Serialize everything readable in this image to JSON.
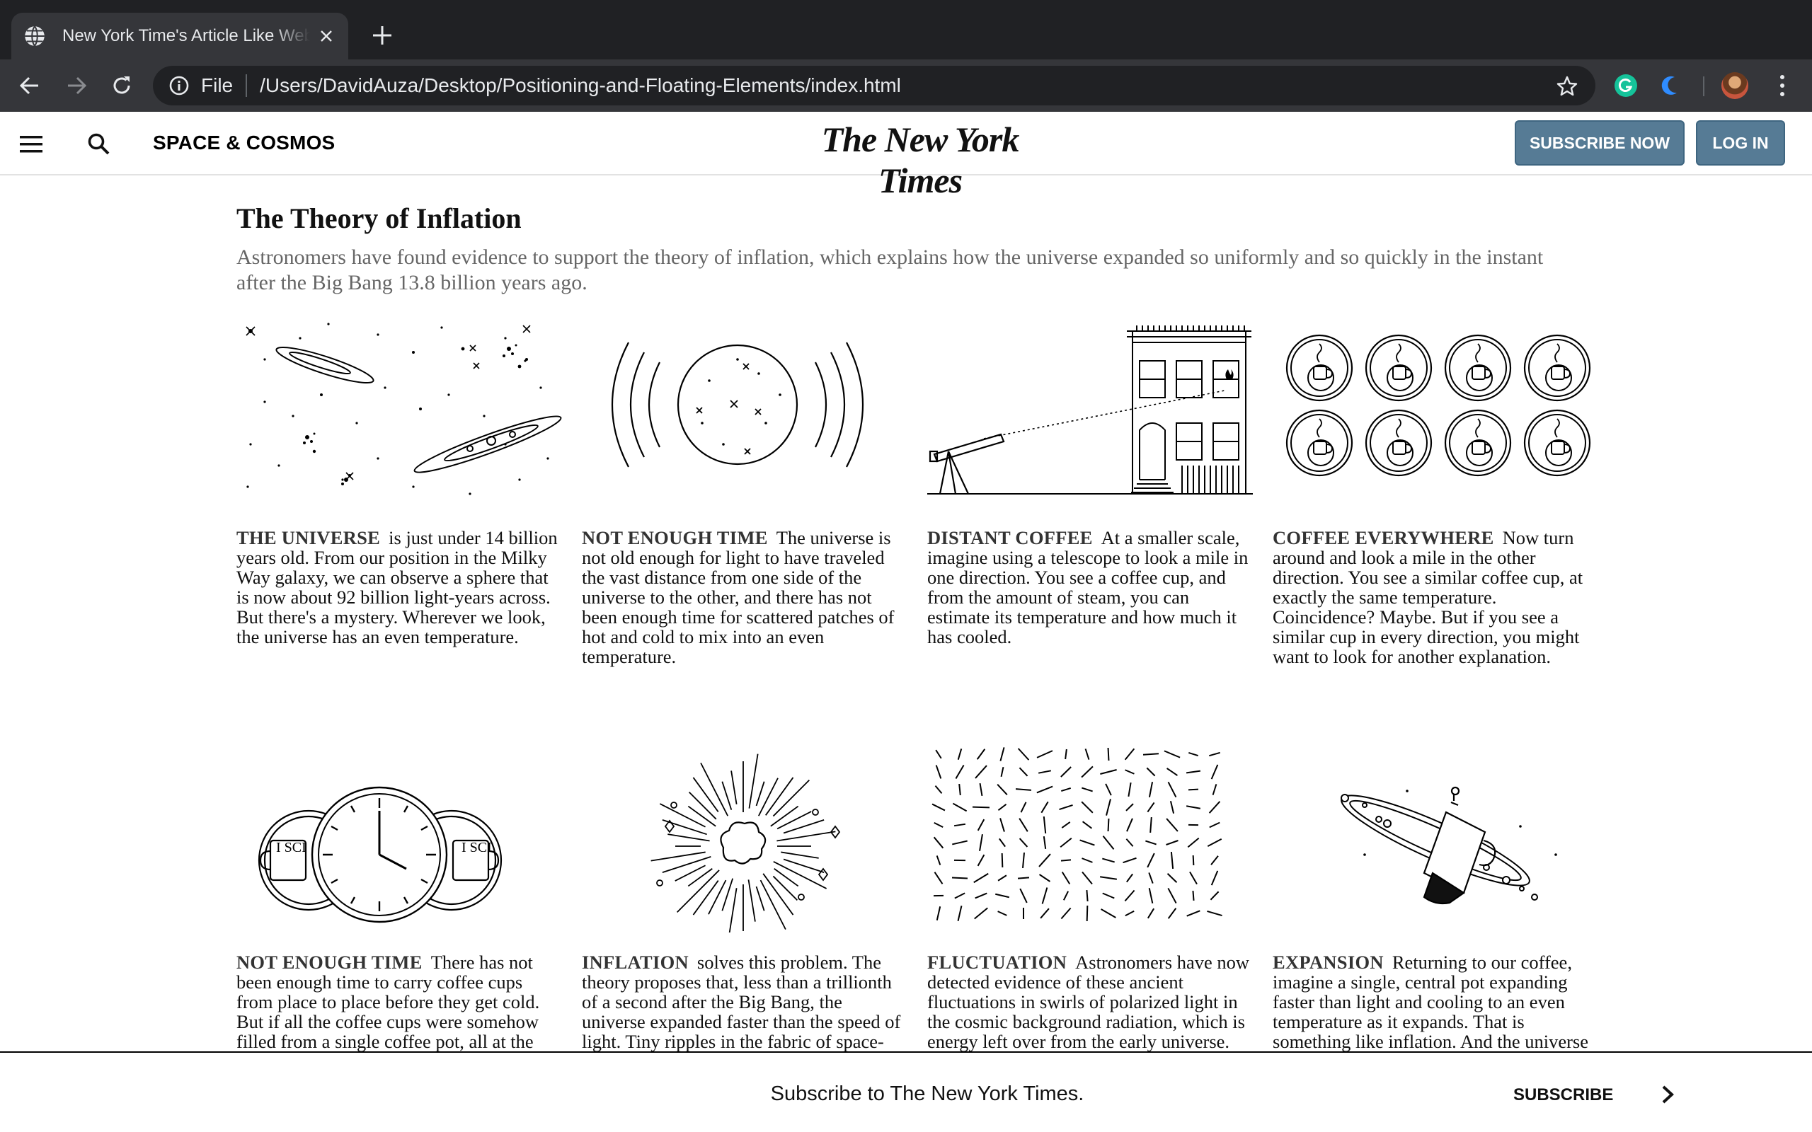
{
  "browser": {
    "tab_title": "New York Time's Article Like Website",
    "url_scheme_label": "File",
    "url": "/Users/DavidAuza/Desktop/Positioning-and-Floating-Elements/index.html"
  },
  "header": {
    "section": "SPACE & COSMOS",
    "masthead": "The New York Times",
    "subscribe_label": "SUBSCRIBE NOW",
    "login_label": "LOG IN"
  },
  "article": {
    "headline": "The Theory of Inflation",
    "summary": "Astronomers have found evidence to support the theory of inflation, which explains how the universe expanded so uniformly and so quickly in the instant after the Big Bang 13.8 billion years ago.",
    "cards": [
      {
        "icon": "galaxies-illustration",
        "label": "THE UNIVERSE",
        "text": "is just under 14 billion years old. From our position in the Milky Way galaxy, we can observe a sphere that is now about 92 billion light-years across. But there's a mystery. Wherever we look, the universe has an even temperature."
      },
      {
        "icon": "sphere-illustration",
        "label": "NOT ENOUGH TIME",
        "text": "The universe is not old enough for light to have traveled the vast distance from one side of the universe to the other, and there has not been enough time for scattered patches of hot and cold to mix into an even temperature."
      },
      {
        "icon": "telescope-illustration",
        "label": "DISTANT COFFEE",
        "text": "At a smaller scale, imagine using a telescope to look a mile in one direction. You see a coffee cup, and from the amount of steam, you can estimate its temperature and how much it has cooled."
      },
      {
        "icon": "coffee-cups-illustration",
        "label": "COFFEE EVERYWHERE",
        "text": "Now turn around and look a mile in the other direction. You see a similar coffee cup, at exactly the same temperature. Coincidence? Maybe. But if you see a similar cup in every direction, you might want to look for another explanation."
      },
      {
        "icon": "clock-cups-illustration",
        "label": "NOT ENOUGH TIME",
        "text": "There has not been enough time to carry coffee cups from place to place before they get cold. But if all the coffee cups were somehow filled from a single coffee pot, all at the same time, they would all be at the same temperature."
      },
      {
        "icon": "inflation-burst-illustration",
        "label": "INFLATION",
        "text": "solves this problem. The theory proposes that, less than a trillionth of a second after the Big Bang, the universe expanded faster than the speed of light. Tiny ripples in the fabric of space-time were stretched across the cosmos."
      },
      {
        "icon": "fluctuation-field-illustration",
        "label": "FLUCTUATION",
        "text": "Astronomers have now detected evidence of these ancient fluctuations in swirls of polarized light in the cosmic background radiation, which is energy left over from the early universe."
      },
      {
        "icon": "expansion-illustration",
        "label": "EXPANSION",
        "text": "Returning to our coffee, imagine a single, central pot expanding faster than light and cooling to an even temperature as it expands. That is something like inflation. And the universe has the same temperature everywhere."
      }
    ],
    "cup_text": "I SCI"
  },
  "subscribe_bar": {
    "text": "Subscribe to The New York Times.",
    "link": "SUBSCRIBE"
  },
  "colors": {
    "chrome_dark": "#202124",
    "chrome_toolbar": "#35363a",
    "button_blue": "#567b95",
    "summary_gray": "#666666"
  }
}
